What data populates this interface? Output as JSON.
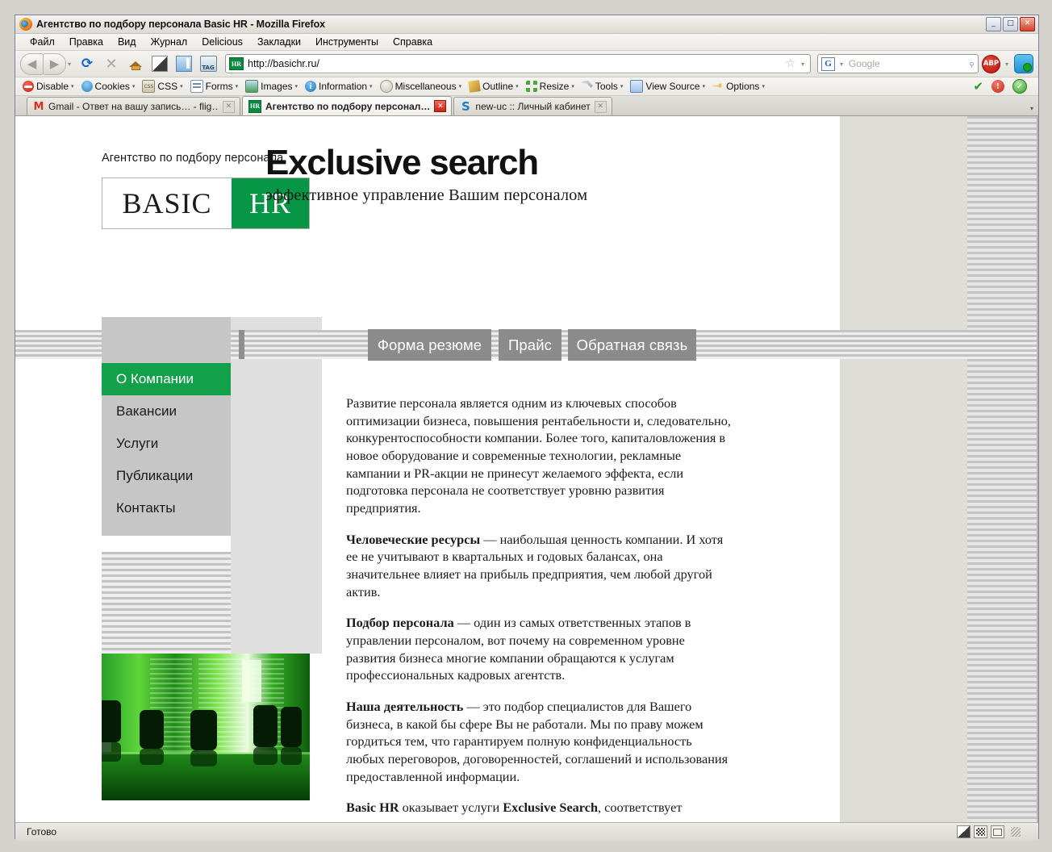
{
  "window": {
    "title": "Агентство по подбору персонала Basic HR - Mozilla Firefox",
    "minimize": "_",
    "maximize": "□",
    "close": "✕"
  },
  "menubar": [
    {
      "label": "Файл"
    },
    {
      "label": "Правка"
    },
    {
      "label": "Вид"
    },
    {
      "label": "Журнал"
    },
    {
      "label": "Delicious"
    },
    {
      "label": "Закладки"
    },
    {
      "label": "Инструменты"
    },
    {
      "label": "Справка"
    }
  ],
  "toolbar": {
    "back_icon": "back-arrow-icon",
    "forward_icon": "forward-arrow-icon",
    "reload_glyph": "⟳",
    "stop_glyph": "✕",
    "tag_label": "TAG",
    "url": "http://basichr.ru/",
    "favicon_text": "HR",
    "star_glyph": "☆",
    "search_engine": "G",
    "search_placeholder": "Google",
    "magnifier_glyph": "⌕",
    "abp_label": "ABP",
    "caret": "▾"
  },
  "devbar": {
    "items": [
      {
        "label": "Disable",
        "icon": "disable-icon"
      },
      {
        "label": "Cookies",
        "icon": "cookies-icon"
      },
      {
        "label": "CSS",
        "icon": "css-icon"
      },
      {
        "label": "Forms",
        "icon": "forms-icon"
      },
      {
        "label": "Images",
        "icon": "images-icon"
      },
      {
        "label": "Information",
        "icon": "information-icon"
      },
      {
        "label": "Miscellaneous",
        "icon": "miscellaneous-icon"
      },
      {
        "label": "Outline",
        "icon": "outline-icon"
      },
      {
        "label": "Resize",
        "icon": "resize-icon"
      },
      {
        "label": "Tools",
        "icon": "tools-icon"
      },
      {
        "label": "View Source",
        "icon": "view-source-icon"
      },
      {
        "label": "Options",
        "icon": "options-icon"
      }
    ],
    "status_check": "✔",
    "status_error": "!",
    "status_ok": "✓"
  },
  "tabs": [
    {
      "label": "Gmail - Ответ на вашу запись… - flig…",
      "icon": "gmail-icon",
      "active": false,
      "close": "✕"
    },
    {
      "label": "Агентство по подбору персонал…",
      "icon": "hr-favicon",
      "active": true,
      "close": "✕"
    },
    {
      "label": "new-uc :: Личный кабинет",
      "icon": "skype-style-icon",
      "active": false,
      "close": "✕"
    }
  ],
  "page": {
    "agency_line": "Агентство по подбору персонала",
    "logo": {
      "left": "BASIC",
      "right": "HR",
      "green": "#069646"
    },
    "slogan_title": "Exclusive search",
    "slogan_sub": "эффективное управление Вашим персоналом",
    "topnav": [
      {
        "label": "Форма резюме"
      },
      {
        "label": "Прайс"
      },
      {
        "label": "Обратная связь"
      }
    ],
    "sidebar": [
      {
        "label": "О Компании",
        "active": true
      },
      {
        "label": "Вакансии",
        "active": false
      },
      {
        "label": "Услуги",
        "active": false
      },
      {
        "label": "Публикации",
        "active": false
      },
      {
        "label": "Контакты",
        "active": false
      }
    ],
    "accent_green": "#13a04a",
    "paragraphs": [
      {
        "lead": "",
        "text": "Развитие персонала является одним из ключевых способов оптимизации бизнеса, повышения рентабельности и, следовательно, конкурентоспособности компании. Более того, капиталовложения в новое оборудование и современные технологии, рекламные кампании и PR-акции не принесут желаемого эффекта, если подготовка персонала не соответствует уровню развития предприятия."
      },
      {
        "lead": "Человеческие ресурсы",
        "text": " — наибольшая ценность компании. И хотя ее не учитывают в квартальных и годовых балансах, она значительнее влияет на прибыль предприятия, чем любой другой актив."
      },
      {
        "lead": "Подбор персонала",
        "text": " — один из самых ответственных этапов в управлении персоналом, вот почему на современном уровне развития бизнеса многие компании обращаются к услугам профессиональных кадровых агентств."
      },
      {
        "lead": "Наша деятельность",
        "text": " — это подбор специалистов для Вашего бизнеса, в какой бы сфере Вы не работали. Мы по праву можем гордиться тем, что гарантируем полную конфиденциальность любых переговоров, договоренностей, соглашений и использования предоставленной информации."
      },
      {
        "lead": "Basic HR",
        "text": " оказывает услуги ",
        "lead2": "Exclusive Search",
        "text2": ", соответствует высоким, практическим и этическим стандартам и нормам."
      }
    ],
    "photo_alt": "green-tinted-office-photo"
  },
  "statusbar": {
    "text": "Готово"
  }
}
